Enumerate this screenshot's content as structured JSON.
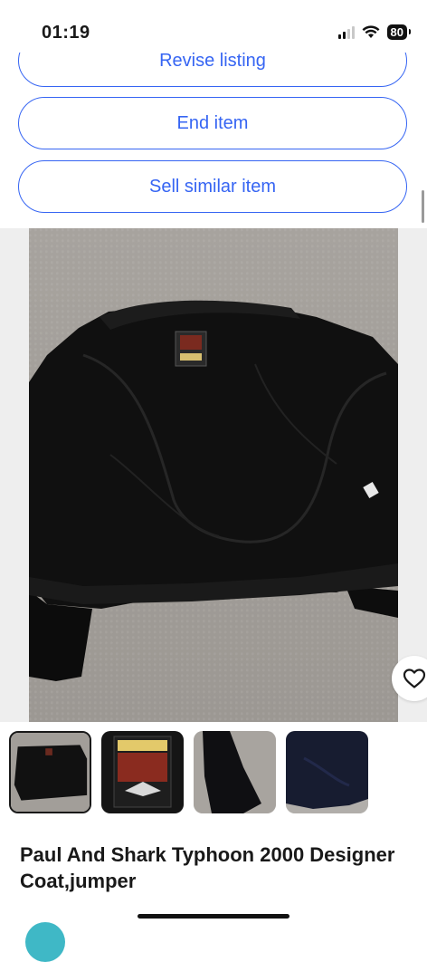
{
  "status_bar": {
    "time": "01:19",
    "battery": "80"
  },
  "actions": {
    "revise_label": "Revise listing",
    "end_label": "End item",
    "sell_similar_label": "Sell similar item"
  },
  "gallery": {
    "thumbnails": [
      {
        "icon": "jacket-lining-photo",
        "selected": true
      },
      {
        "icon": "brand-label-photo",
        "selected": false
      },
      {
        "icon": "sleeve-detail-photo",
        "selected": false
      },
      {
        "icon": "fabric-closeup-photo",
        "selected": false
      }
    ],
    "favorite_icon": "heart-icon"
  },
  "item": {
    "title": "Paul And Shark Typhoon 2000 Designer Coat,jumper"
  },
  "colors": {
    "accent": "#3665f3",
    "text": "#191919"
  }
}
